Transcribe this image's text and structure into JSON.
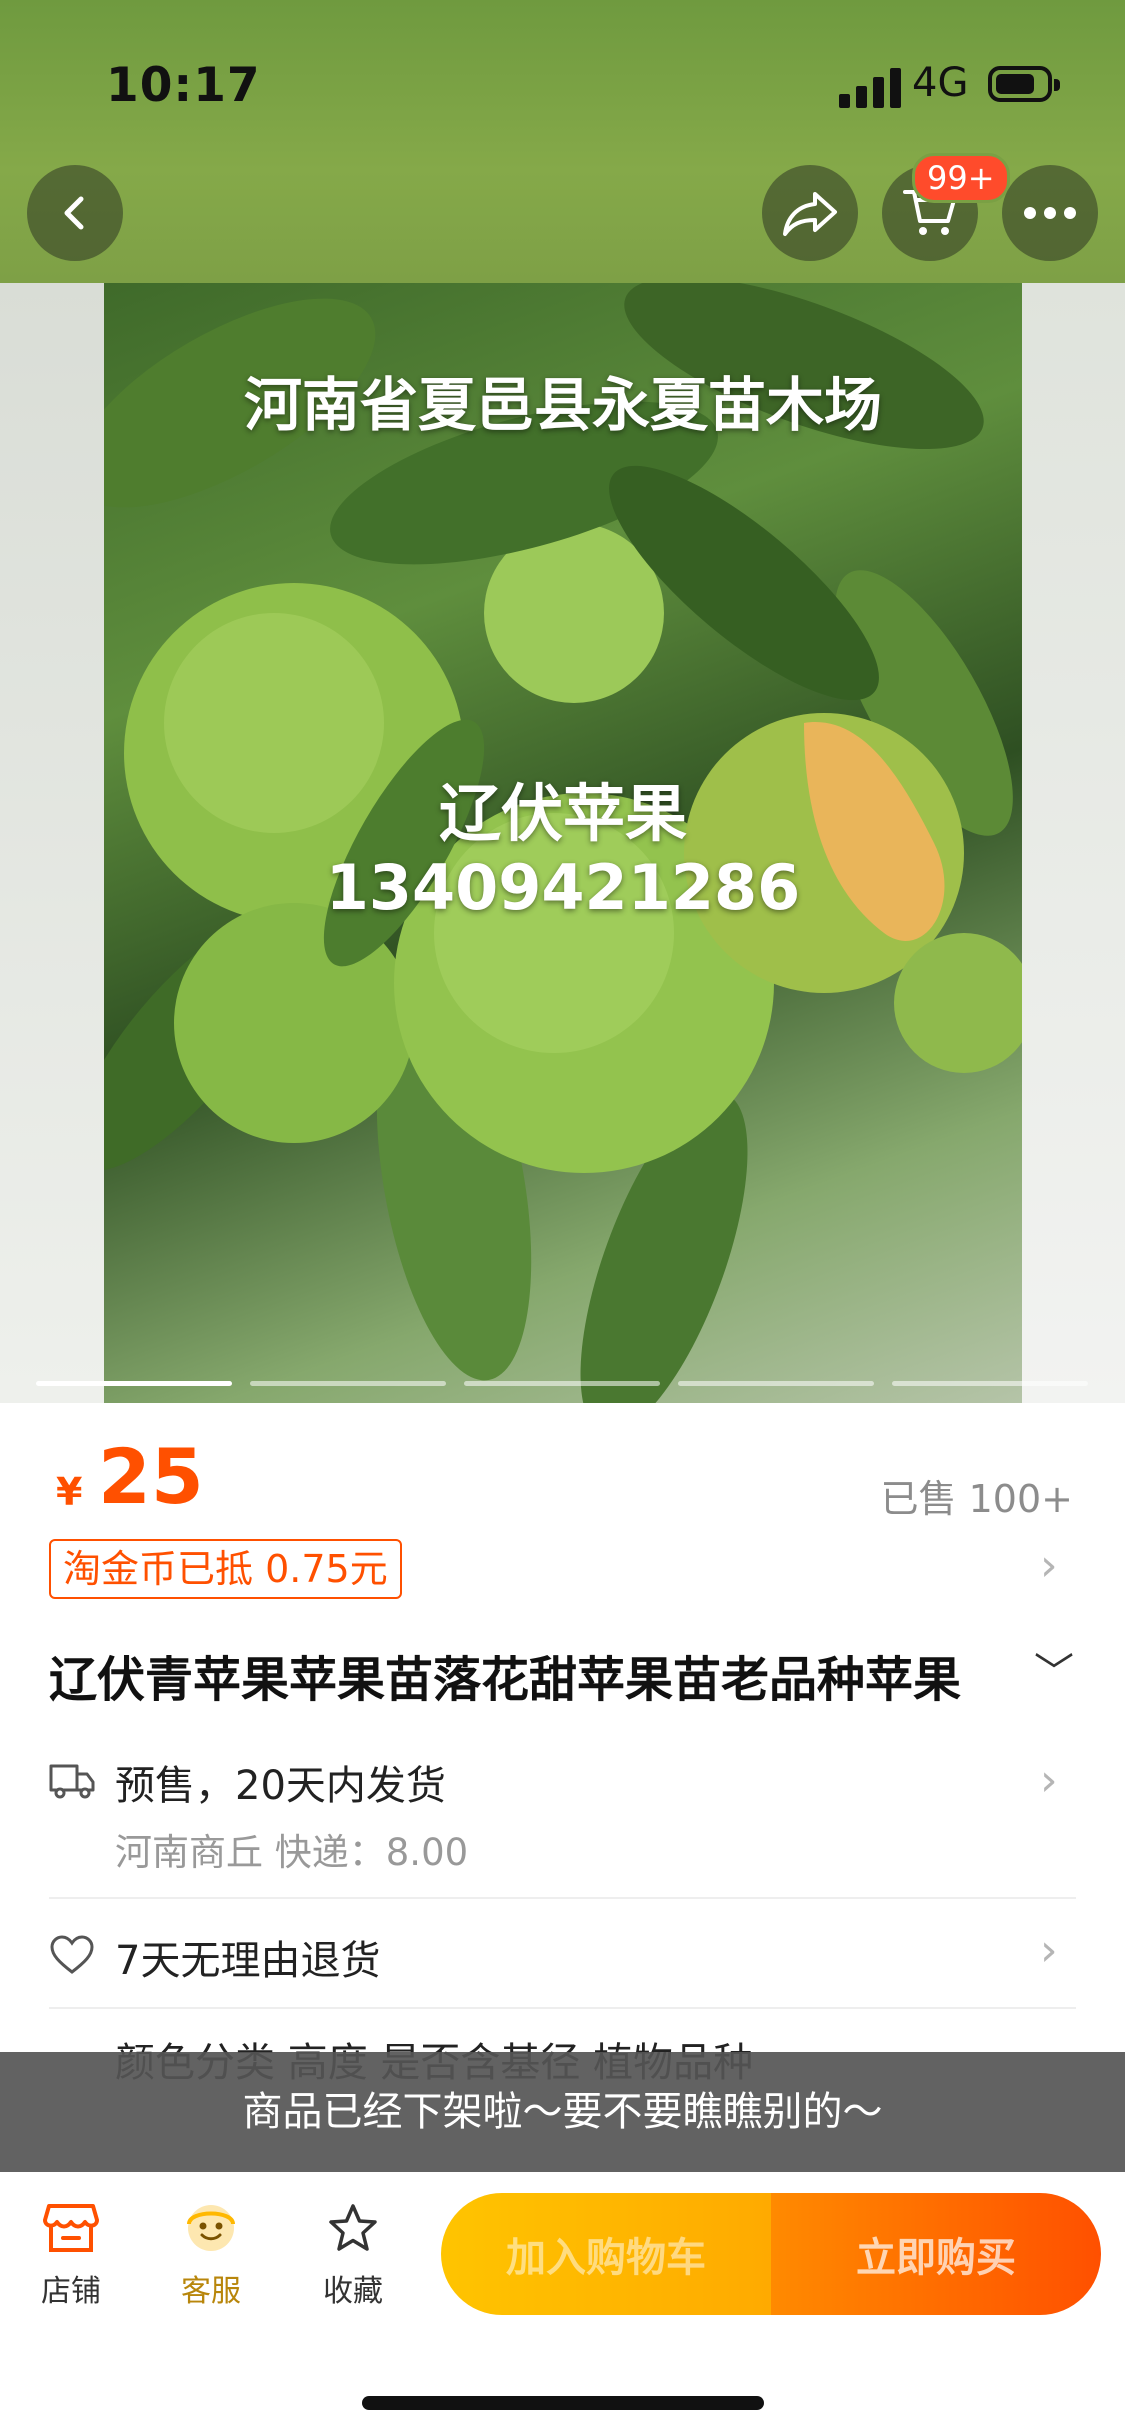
{
  "status_bar": {
    "time": "10:17",
    "network": "4G"
  },
  "header": {
    "cart_badge": "99+"
  },
  "product_image": {
    "overlay_title": "河南省夏邑县永夏苗木场",
    "overlay_name": "辽伏苹果",
    "overlay_phone": "13409421286",
    "page_count": 5,
    "current_page": 1
  },
  "price": {
    "symbol": "¥",
    "value": "25",
    "sold": "已售 100+"
  },
  "coin_discount": "淘金币已抵 0.75元",
  "title": "辽伏青苹果苹果苗落花甜苹果苗老品种苹果",
  "shipping": {
    "main": "预售，20天内发货",
    "sub": "河南商丘  快递：8.00"
  },
  "returns": "7天无理由退货",
  "partial_row": "颜色分类   高度   是否含基径   植物品种",
  "toast": "商品已经下架啦～要不要瞧瞧别的～",
  "bottom_bar": {
    "shop_label": "店铺",
    "service_label": "客服",
    "favorite_label": "收藏",
    "add_to_cart": "加入购物车",
    "buy_now": "立即购买"
  },
  "colors": {
    "accent": "#ff5000",
    "cart_button": "#ffb700",
    "toast_bg": "#555555"
  }
}
